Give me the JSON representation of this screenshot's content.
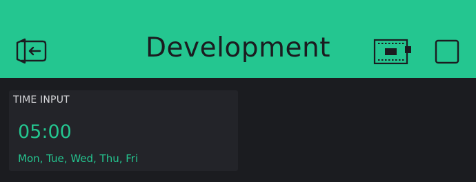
{
  "header": {
    "title": "Development",
    "background_color": "#24c690",
    "icons": [
      "exit-icon",
      "device-icon",
      "stop-icon"
    ]
  },
  "widget": {
    "label": "TIME INPUT",
    "time_value": "05:00",
    "days_value": "Mon, Tue, Wed, Thu, Fri",
    "accent_color": "#24c690"
  },
  "canvas_background": "#1b1c20"
}
